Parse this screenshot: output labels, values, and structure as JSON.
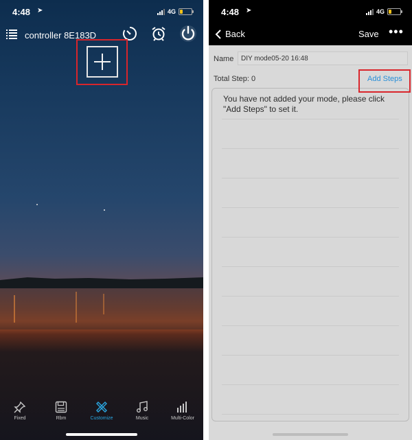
{
  "left_screen": {
    "status": {
      "time": "4:48",
      "network": "4G"
    },
    "header": {
      "device_name": "controller 8E183D"
    },
    "tabs": [
      {
        "label": "Fixed",
        "icon": "pin-icon"
      },
      {
        "label": "Rbm",
        "icon": "save-icon"
      },
      {
        "label": "Customize",
        "icon": "customize-icon",
        "active": true
      },
      {
        "label": "Music",
        "icon": "music-icon"
      },
      {
        "label": "Multi-Color",
        "icon": "bars-icon"
      }
    ]
  },
  "right_screen": {
    "status": {
      "time": "4:48",
      "network": "4G"
    },
    "header": {
      "back_label": "Back",
      "save_label": "Save",
      "more_label": "•••"
    },
    "name_label": "Name",
    "name_value": "DIY mode05-20 16:48",
    "total_step_label": "Total Step: 0",
    "add_steps_label": "Add Steps",
    "empty_message": "You have not added your mode, please click \"Add Steps\" to set it."
  },
  "colors": {
    "accent": "#2aa6e0",
    "link": "#2a8fd8",
    "highlight": "#d9252b",
    "content_bg": "#d9d9d9"
  }
}
